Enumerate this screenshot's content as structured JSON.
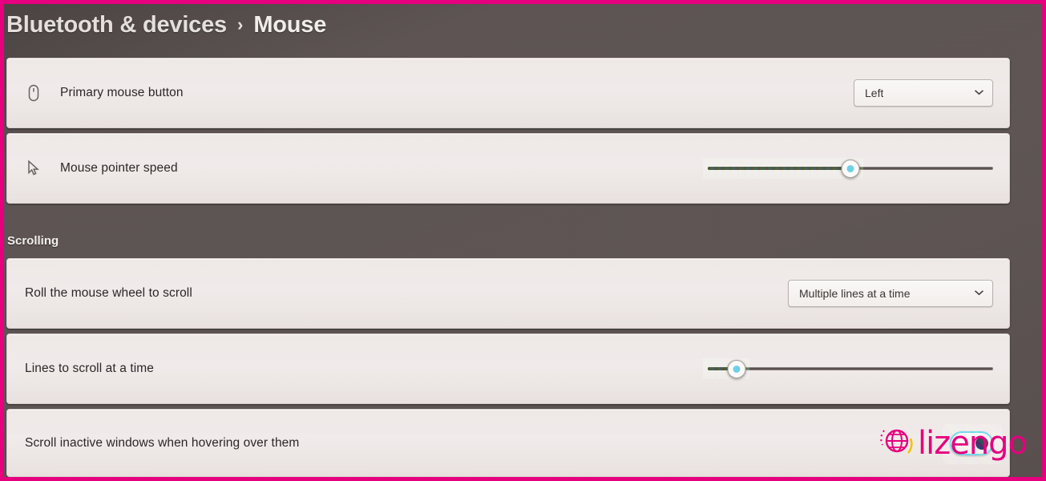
{
  "header": {
    "parent_crumb": "Bluetooth & devices",
    "separator": "›",
    "current_crumb": "Mouse"
  },
  "sections": {
    "scrolling_title": "Scrolling"
  },
  "rows": {
    "primary_mouse_button": {
      "label": "Primary mouse button",
      "icon": "mouse-icon",
      "control": "dropdown",
      "value": "Left",
      "chevron": "⌄"
    },
    "mouse_pointer_speed": {
      "label": "Mouse pointer speed",
      "icon": "pointer-speed-icon",
      "control": "slider",
      "value_percent": 50
    },
    "roll_mouse_wheel": {
      "label": "Roll the mouse wheel to scroll",
      "control": "dropdown",
      "value": "Multiple lines at a time",
      "chevron": "⌄"
    },
    "lines_to_scroll": {
      "label": "Lines to scroll at a time",
      "control": "slider",
      "value_percent": 10
    },
    "scroll_inactive_windows": {
      "label": "Scroll inactive windows when hovering over them",
      "control": "toggle",
      "state": "On"
    }
  },
  "watermark": {
    "text": "lizengo",
    "icon": "globe-icon"
  },
  "colors": {
    "accent_frame": "#e6007e",
    "page_background": "#5a5150",
    "card_background": "#efe9e7",
    "text_primary": "#2c2726",
    "header_text": "#f2eeec",
    "toggle_accent": "#57d3ea"
  }
}
